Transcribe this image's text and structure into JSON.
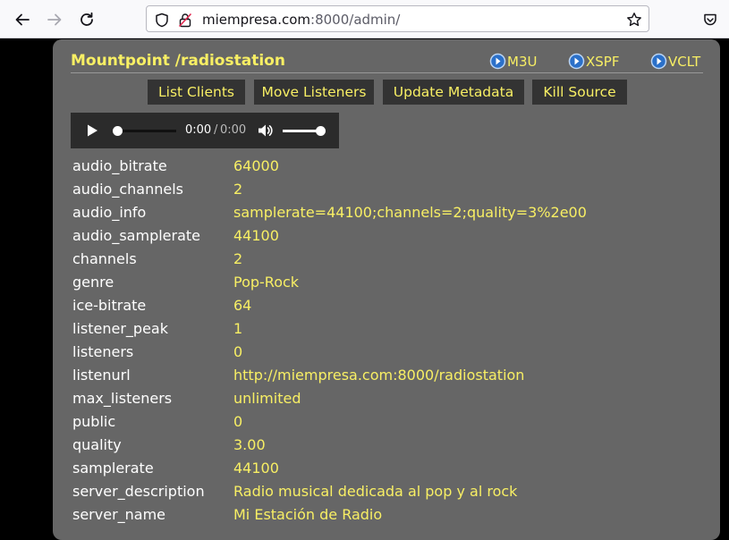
{
  "browser": {
    "url_host": "miempresa.com",
    "url_rest": ":8000/admin/"
  },
  "mount": {
    "title": "Mountpoint /radiostation",
    "playlists": [
      {
        "label": "M3U"
      },
      {
        "label": "XSPF"
      },
      {
        "label": "VCLT"
      }
    ],
    "actions": [
      {
        "label": "List Clients"
      },
      {
        "label": "Move Listeners"
      },
      {
        "label": "Update Metadata"
      },
      {
        "label": "Kill Source"
      }
    ]
  },
  "player": {
    "current_time": "0:00",
    "separator": "/",
    "duration": "0:00",
    "progress": 0,
    "volume": 1.0
  },
  "stats": [
    {
      "key": "audio_bitrate",
      "value": "64000"
    },
    {
      "key": "audio_channels",
      "value": "2"
    },
    {
      "key": "audio_info",
      "value": "samplerate=44100;channels=2;quality=3%2e00"
    },
    {
      "key": "audio_samplerate",
      "value": "44100"
    },
    {
      "key": "channels",
      "value": "2"
    },
    {
      "key": "genre",
      "value": "Pop-Rock"
    },
    {
      "key": "ice-bitrate",
      "value": "64"
    },
    {
      "key": "listener_peak",
      "value": "1"
    },
    {
      "key": "listeners",
      "value": "0"
    },
    {
      "key": "listenurl",
      "value": "http://miempresa.com:8000/radiostation"
    },
    {
      "key": "max_listeners",
      "value": "unlimited"
    },
    {
      "key": "public",
      "value": "0"
    },
    {
      "key": "quality",
      "value": "3.00"
    },
    {
      "key": "samplerate",
      "value": "44100"
    },
    {
      "key": "server_description",
      "value": "Radio musical dedicada al pop y al rock"
    },
    {
      "key": "server_name",
      "value": "Mi Estación de Radio"
    }
  ],
  "colors": {
    "accent": "#f8ef64",
    "panel": "#666666",
    "button_bg": "#333333"
  },
  "icons": [
    "back-arrow-icon",
    "forward-arrow-icon",
    "reload-icon",
    "shield-icon",
    "insecure-lock-icon",
    "bookmark-star-icon",
    "pocket-icon",
    "play-icon",
    "volume-icon",
    "tunein-icon"
  ]
}
